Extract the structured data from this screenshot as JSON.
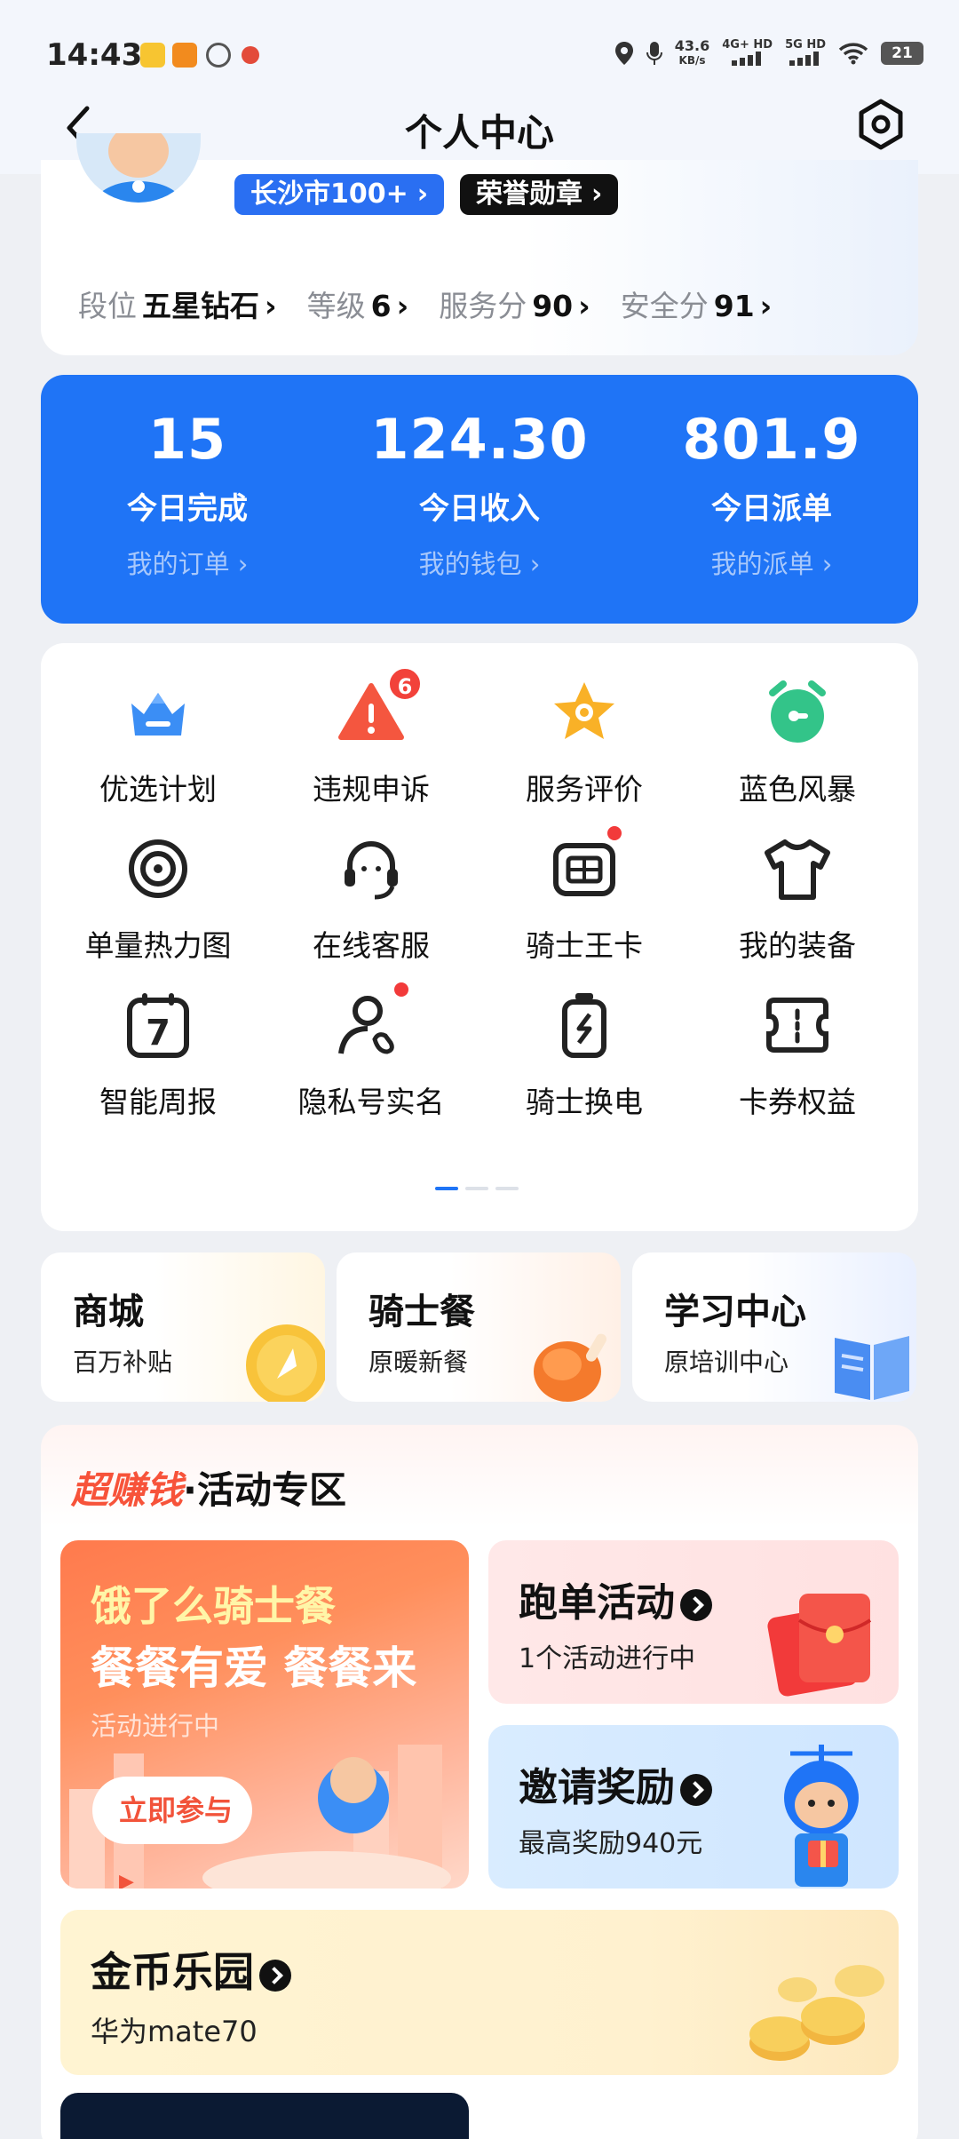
{
  "status_bar": {
    "time": "14:43",
    "net_speed": "43.6",
    "net_unit": "KB/s",
    "sig1": "4G+ HD",
    "sig2": "5G HD",
    "battery": "21"
  },
  "header": {
    "title": "个人中心"
  },
  "profile": {
    "city_badge": "长沙市100+",
    "honor_badge": "荣誉勋章",
    "stats": [
      {
        "label": "段位",
        "value": "五星钻石"
      },
      {
        "label": "等级",
        "value": "6"
      },
      {
        "label": "服务分",
        "value": "90"
      },
      {
        "label": "安全分",
        "value": "91"
      }
    ]
  },
  "today": [
    {
      "value": "15",
      "label": "今日完成",
      "link": "我的订单"
    },
    {
      "value": "124.30",
      "label": "今日收入",
      "link": "我的钱包"
    },
    {
      "value": "801.9",
      "label": "今日派单",
      "link": "我的派单"
    }
  ],
  "grid": {
    "items": [
      {
        "label": "优选计划",
        "icon": "crown-icon"
      },
      {
        "label": "违规申诉",
        "icon": "warning-icon",
        "badge": "6"
      },
      {
        "label": "服务评价",
        "icon": "star-icon"
      },
      {
        "label": "蓝色风暴",
        "icon": "alarm-clock-icon"
      },
      {
        "label": "单量热力图",
        "icon": "heatmap-icon"
      },
      {
        "label": "在线客服",
        "icon": "headset-icon"
      },
      {
        "label": "骑士王卡",
        "icon": "sim-card-icon"
      },
      {
        "label": "我的装备",
        "icon": "tshirt-icon"
      },
      {
        "label": "智能周报",
        "icon": "calendar-icon",
        "glyph": "7"
      },
      {
        "label": "隐私号实名",
        "icon": "user-phone-icon"
      },
      {
        "label": "骑士换电",
        "icon": "battery-swap-icon"
      },
      {
        "label": "卡券权益",
        "icon": "coupon-icon"
      }
    ],
    "page_count": 3,
    "current_page": 1
  },
  "mini_cards": [
    {
      "title": "商城",
      "subtitle": "百万补贴",
      "icon": "coin-icon"
    },
    {
      "title": "骑士餐",
      "subtitle": "原暖新餐",
      "icon": "chicken-leg-icon"
    },
    {
      "title": "学习中心",
      "subtitle": "原培训中心",
      "icon": "book-icon"
    }
  ],
  "activity": {
    "title_highlight": "超赚钱",
    "title_rest": "·活动专区",
    "promo": {
      "line1": "饿了么骑士餐",
      "line2": "餐餐有爱 餐餐来",
      "status": "活动进行中",
      "button": "立即参与"
    },
    "run_orders": {
      "title": "跑单活动",
      "subtitle": "1个活动进行中"
    },
    "invite": {
      "title": "邀请奖励",
      "subtitle": "最高奖励940元"
    },
    "gold_park": {
      "title": "金币乐园",
      "subtitle": "华为mate70"
    }
  },
  "colors": {
    "accent": "#1f74f6",
    "red": "#f23a3a",
    "orange": "#ff7a4d"
  }
}
